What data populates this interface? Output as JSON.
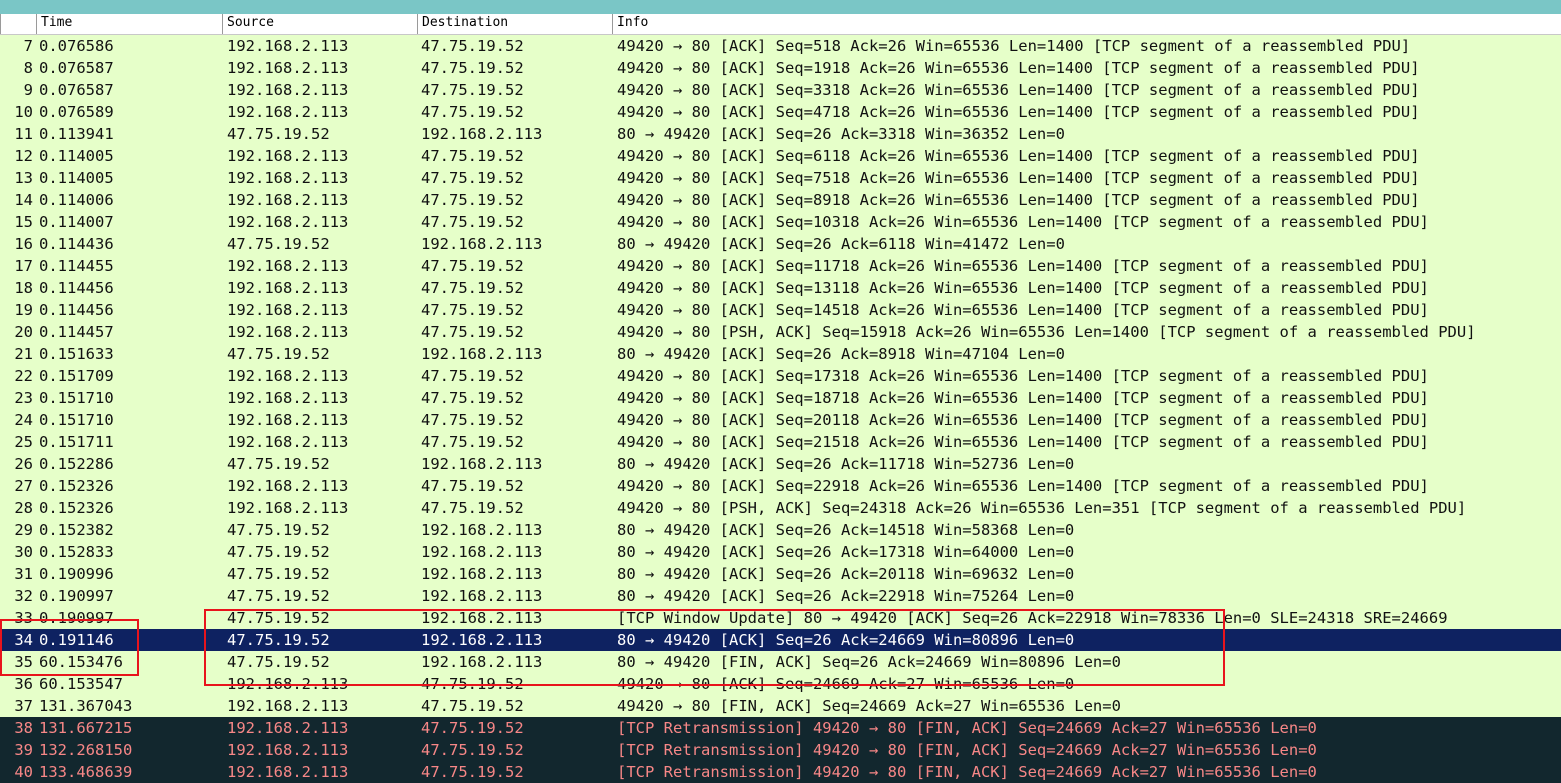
{
  "columns": {
    "time": "Time",
    "source": "Source",
    "destination": "Destination",
    "info": "Info"
  },
  "colors": {
    "tcp_row": "#e6ffc9",
    "selected": "#0e2261",
    "retransmission_bg": "#12272e",
    "retransmission_text": "#f78787",
    "annotation": "#e8141c",
    "title_bar": "#7ac6c6"
  },
  "selected_packet": "34",
  "packets": [
    {
      "no": "7",
      "time": "0.076586",
      "src": "192.168.2.113",
      "dst": "47.75.19.52",
      "info": "49420 → 80 [ACK] Seq=518 Ack=26 Win=65536 Len=1400 [TCP segment of a reassembled PDU]"
    },
    {
      "no": "8",
      "time": "0.076587",
      "src": "192.168.2.113",
      "dst": "47.75.19.52",
      "info": "49420 → 80 [ACK] Seq=1918 Ack=26 Win=65536 Len=1400 [TCP segment of a reassembled PDU]"
    },
    {
      "no": "9",
      "time": "0.076587",
      "src": "192.168.2.113",
      "dst": "47.75.19.52",
      "info": "49420 → 80 [ACK] Seq=3318 Ack=26 Win=65536 Len=1400 [TCP segment of a reassembled PDU]"
    },
    {
      "no": "10",
      "time": "0.076589",
      "src": "192.168.2.113",
      "dst": "47.75.19.52",
      "info": "49420 → 80 [ACK] Seq=4718 Ack=26 Win=65536 Len=1400 [TCP segment of a reassembled PDU]"
    },
    {
      "no": "11",
      "time": "0.113941",
      "src": "47.75.19.52",
      "dst": "192.168.2.113",
      "info": "80 → 49420 [ACK] Seq=26 Ack=3318 Win=36352 Len=0"
    },
    {
      "no": "12",
      "time": "0.114005",
      "src": "192.168.2.113",
      "dst": "47.75.19.52",
      "info": "49420 → 80 [ACK] Seq=6118 Ack=26 Win=65536 Len=1400 [TCP segment of a reassembled PDU]"
    },
    {
      "no": "13",
      "time": "0.114005",
      "src": "192.168.2.113",
      "dst": "47.75.19.52",
      "info": "49420 → 80 [ACK] Seq=7518 Ack=26 Win=65536 Len=1400 [TCP segment of a reassembled PDU]"
    },
    {
      "no": "14",
      "time": "0.114006",
      "src": "192.168.2.113",
      "dst": "47.75.19.52",
      "info": "49420 → 80 [ACK] Seq=8918 Ack=26 Win=65536 Len=1400 [TCP segment of a reassembled PDU]"
    },
    {
      "no": "15",
      "time": "0.114007",
      "src": "192.168.2.113",
      "dst": "47.75.19.52",
      "info": "49420 → 80 [ACK] Seq=10318 Ack=26 Win=65536 Len=1400 [TCP segment of a reassembled PDU]"
    },
    {
      "no": "16",
      "time": "0.114436",
      "src": "47.75.19.52",
      "dst": "192.168.2.113",
      "info": "80 → 49420 [ACK] Seq=26 Ack=6118 Win=41472 Len=0"
    },
    {
      "no": "17",
      "time": "0.114455",
      "src": "192.168.2.113",
      "dst": "47.75.19.52",
      "info": "49420 → 80 [ACK] Seq=11718 Ack=26 Win=65536 Len=1400 [TCP segment of a reassembled PDU]"
    },
    {
      "no": "18",
      "time": "0.114456",
      "src": "192.168.2.113",
      "dst": "47.75.19.52",
      "info": "49420 → 80 [ACK] Seq=13118 Ack=26 Win=65536 Len=1400 [TCP segment of a reassembled PDU]"
    },
    {
      "no": "19",
      "time": "0.114456",
      "src": "192.168.2.113",
      "dst": "47.75.19.52",
      "info": "49420 → 80 [ACK] Seq=14518 Ack=26 Win=65536 Len=1400 [TCP segment of a reassembled PDU]"
    },
    {
      "no": "20",
      "time": "0.114457",
      "src": "192.168.2.113",
      "dst": "47.75.19.52",
      "info": "49420 → 80 [PSH, ACK] Seq=15918 Ack=26 Win=65536 Len=1400 [TCP segment of a reassembled PDU]"
    },
    {
      "no": "21",
      "time": "0.151633",
      "src": "47.75.19.52",
      "dst": "192.168.2.113",
      "info": "80 → 49420 [ACK] Seq=26 Ack=8918 Win=47104 Len=0"
    },
    {
      "no": "22",
      "time": "0.151709",
      "src": "192.168.2.113",
      "dst": "47.75.19.52",
      "info": "49420 → 80 [ACK] Seq=17318 Ack=26 Win=65536 Len=1400 [TCP segment of a reassembled PDU]"
    },
    {
      "no": "23",
      "time": "0.151710",
      "src": "192.168.2.113",
      "dst": "47.75.19.52",
      "info": "49420 → 80 [ACK] Seq=18718 Ack=26 Win=65536 Len=1400 [TCP segment of a reassembled PDU]"
    },
    {
      "no": "24",
      "time": "0.151710",
      "src": "192.168.2.113",
      "dst": "47.75.19.52",
      "info": "49420 → 80 [ACK] Seq=20118 Ack=26 Win=65536 Len=1400 [TCP segment of a reassembled PDU]"
    },
    {
      "no": "25",
      "time": "0.151711",
      "src": "192.168.2.113",
      "dst": "47.75.19.52",
      "info": "49420 → 80 [ACK] Seq=21518 Ack=26 Win=65536 Len=1400 [TCP segment of a reassembled PDU]"
    },
    {
      "no": "26",
      "time": "0.152286",
      "src": "47.75.19.52",
      "dst": "192.168.2.113",
      "info": "80 → 49420 [ACK] Seq=26 Ack=11718 Win=52736 Len=0"
    },
    {
      "no": "27",
      "time": "0.152326",
      "src": "192.168.2.113",
      "dst": "47.75.19.52",
      "info": "49420 → 80 [ACK] Seq=22918 Ack=26 Win=65536 Len=1400 [TCP segment of a reassembled PDU]"
    },
    {
      "no": "28",
      "time": "0.152326",
      "src": "192.168.2.113",
      "dst": "47.75.19.52",
      "info": "49420 → 80 [PSH, ACK] Seq=24318 Ack=26 Win=65536 Len=351 [TCP segment of a reassembled PDU]"
    },
    {
      "no": "29",
      "time": "0.152382",
      "src": "47.75.19.52",
      "dst": "192.168.2.113",
      "info": "80 → 49420 [ACK] Seq=26 Ack=14518 Win=58368 Len=0"
    },
    {
      "no": "30",
      "time": "0.152833",
      "src": "47.75.19.52",
      "dst": "192.168.2.113",
      "info": "80 → 49420 [ACK] Seq=26 Ack=17318 Win=64000 Len=0"
    },
    {
      "no": "31",
      "time": "0.190996",
      "src": "47.75.19.52",
      "dst": "192.168.2.113",
      "info": "80 → 49420 [ACK] Seq=26 Ack=20118 Win=69632 Len=0"
    },
    {
      "no": "32",
      "time": "0.190997",
      "src": "47.75.19.52",
      "dst": "192.168.2.113",
      "info": "80 → 49420 [ACK] Seq=26 Ack=22918 Win=75264 Len=0"
    },
    {
      "no": "33",
      "time": "0.190997",
      "src": "47.75.19.52",
      "dst": "192.168.2.113",
      "info": "[TCP Window Update] 80 → 49420 [ACK] Seq=26 Ack=22918 Win=78336 Len=0 SLE=24318 SRE=24669"
    },
    {
      "no": "34",
      "time": "0.191146",
      "src": "47.75.19.52",
      "dst": "192.168.2.113",
      "info": "80 → 49420 [ACK] Seq=26 Ack=24669 Win=80896 Len=0"
    },
    {
      "no": "35",
      "time": "60.153476",
      "src": "47.75.19.52",
      "dst": "192.168.2.113",
      "info": "80 → 49420 [FIN, ACK] Seq=26 Ack=24669 Win=80896 Len=0"
    },
    {
      "no": "36",
      "time": "60.153547",
      "src": "192.168.2.113",
      "dst": "47.75.19.52",
      "info": "49420 → 80 [ACK] Seq=24669 Ack=27 Win=65536 Len=0"
    },
    {
      "no": "37",
      "time": "131.367043",
      "src": "192.168.2.113",
      "dst": "47.75.19.52",
      "info": "49420 → 80 [FIN, ACK] Seq=24669 Ack=27 Win=65536 Len=0"
    },
    {
      "no": "38",
      "time": "131.667215",
      "src": "192.168.2.113",
      "dst": "47.75.19.52",
      "info": "[TCP Retransmission] 49420 → 80 [FIN, ACK] Seq=24669 Ack=27 Win=65536 Len=0"
    },
    {
      "no": "39",
      "time": "132.268150",
      "src": "192.168.2.113",
      "dst": "47.75.19.52",
      "info": "[TCP Retransmission] 49420 → 80 [FIN, ACK] Seq=24669 Ack=27 Win=65536 Len=0"
    },
    {
      "no": "40",
      "time": "133.468639",
      "src": "192.168.2.113",
      "dst": "47.75.19.52",
      "info": "[TCP Retransmission] 49420 → 80 [FIN, ACK] Seq=24669 Ack=27 Win=65536 Len=0"
    }
  ]
}
